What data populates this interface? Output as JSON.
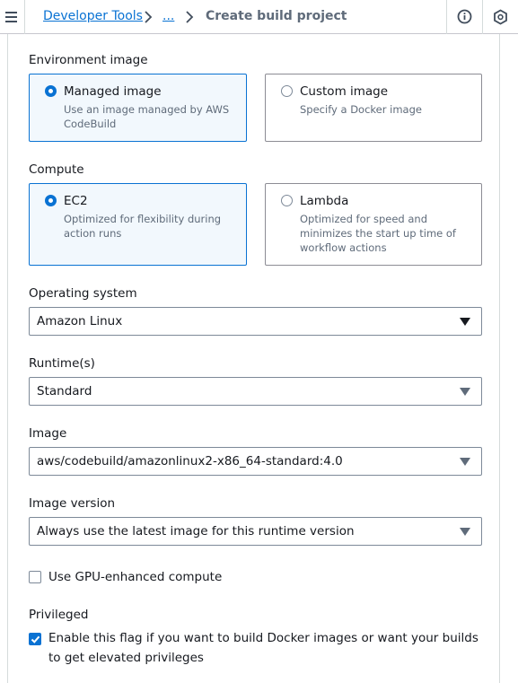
{
  "breadcrumb": {
    "link": "Developer Tools",
    "ellipsis": "...",
    "current": "Create build project"
  },
  "icons": [
    "menu-icon",
    "chevron-right-icon",
    "info-icon",
    "settings-hex-icon"
  ],
  "colors": {
    "accent": "#0972d3",
    "selected_tile_bg": "#f2f8fd",
    "text": "#16191f",
    "muted": "#5f6b7a"
  },
  "environment_image": {
    "label": "Environment image",
    "options": [
      {
        "title": "Managed image",
        "desc": "Use an image managed by AWS CodeBuild",
        "selected": true
      },
      {
        "title": "Custom image",
        "desc": "Specify a Docker image",
        "selected": false
      }
    ]
  },
  "compute": {
    "label": "Compute",
    "options": [
      {
        "title": "EC2",
        "desc": "Optimized for flexibility during action runs",
        "selected": true
      },
      {
        "title": "Lambda",
        "desc": "Optimized for speed and minimizes the start up time of workflow actions",
        "selected": false
      }
    ]
  },
  "operating_system": {
    "label": "Operating system",
    "value": "Amazon Linux"
  },
  "runtimes": {
    "label": "Runtime(s)",
    "value": "Standard"
  },
  "image": {
    "label": "Image",
    "value": "aws/codebuild/amazonlinux2-x86_64-standard:4.0"
  },
  "image_version": {
    "label": "Image version",
    "value": "Always use the latest image for this runtime version"
  },
  "gpu": {
    "label": "Use GPU-enhanced compute",
    "checked": false
  },
  "privileged": {
    "label": "Privileged",
    "checkbox_label": "Enable this flag if you want to build Docker images or want your builds to get elevated privileges",
    "checked": true
  }
}
